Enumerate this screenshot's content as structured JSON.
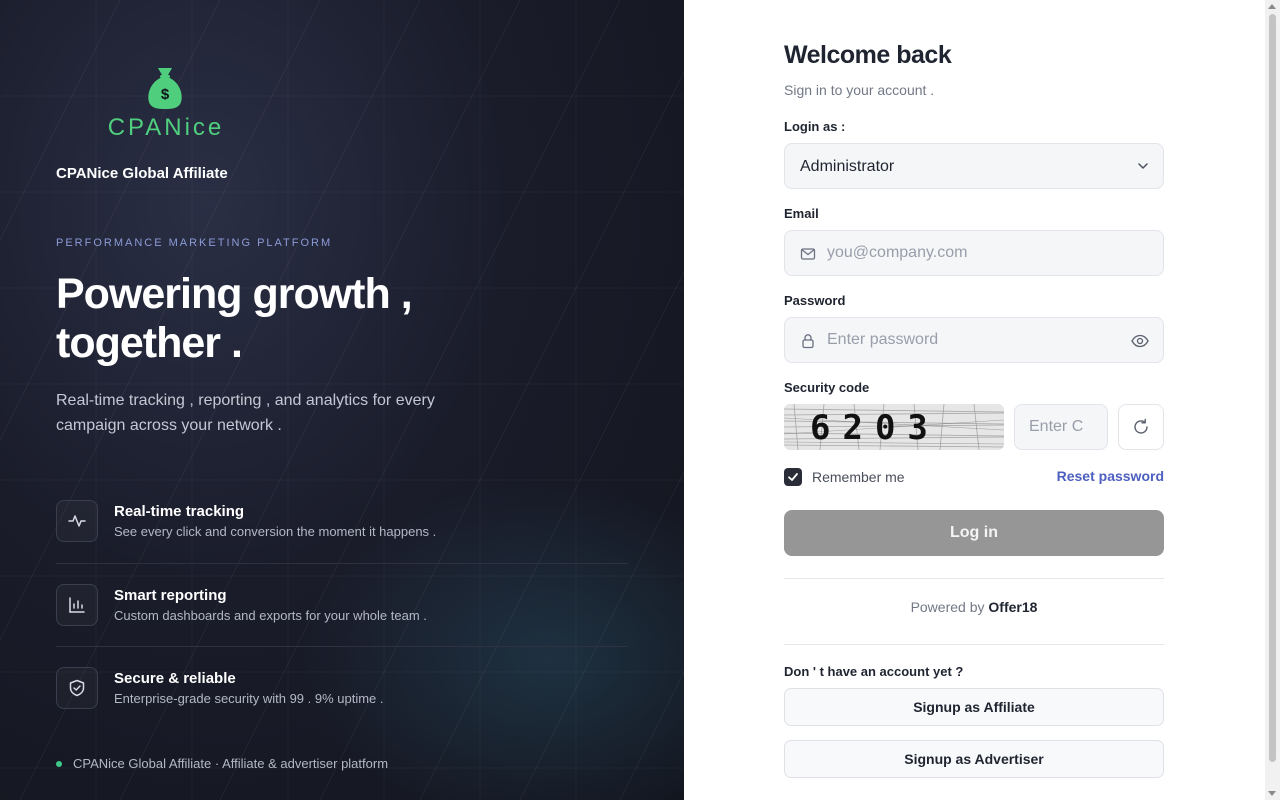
{
  "brand": {
    "logo_text": "CPANice",
    "name": "CPANice Global Affiliate",
    "accent_color": "#4fcf7d"
  },
  "hero": {
    "kicker": "PERFORMANCE MARKETING PLATFORM",
    "headline_line1": "Powering growth ,",
    "headline_line2": "together .",
    "subtitle": "Real-time tracking , reporting , and analytics for every campaign across your network ."
  },
  "features": [
    {
      "icon": "activity-icon",
      "title": "Real-time tracking",
      "description": "See every click and conversion the moment it happens ."
    },
    {
      "icon": "bar-chart-icon",
      "title": "Smart reporting",
      "description": "Custom dashboards and exports for your whole team ."
    },
    {
      "icon": "shield-check-icon",
      "title": "Secure & reliable",
      "description": "Enterprise-grade security with 99 . 9% uptime ."
    }
  ],
  "footer_left": "CPANice Global Affiliate · Affiliate & advertiser platform",
  "form": {
    "title": "Welcome back",
    "subtitle": "Sign in to your account .",
    "login_as_label": "Login as :",
    "login_as_value": "Administrator",
    "email_label": "Email",
    "email_placeholder": "you@company.com",
    "password_label": "Password",
    "password_placeholder": "Enter password",
    "security_label": "Security code",
    "captcha_text": "6203",
    "captcha_placeholder": "Enter C",
    "remember_label": "Remember me",
    "remember_checked": true,
    "reset_label": "Reset password",
    "login_button": "Log in",
    "powered_prefix": "Powered by",
    "powered_brand": "Offer18",
    "no_account": "Don ' t have an account yet ?",
    "signup_affiliate": "Signup as Affiliate",
    "signup_advertiser": "Signup as Advertiser"
  }
}
